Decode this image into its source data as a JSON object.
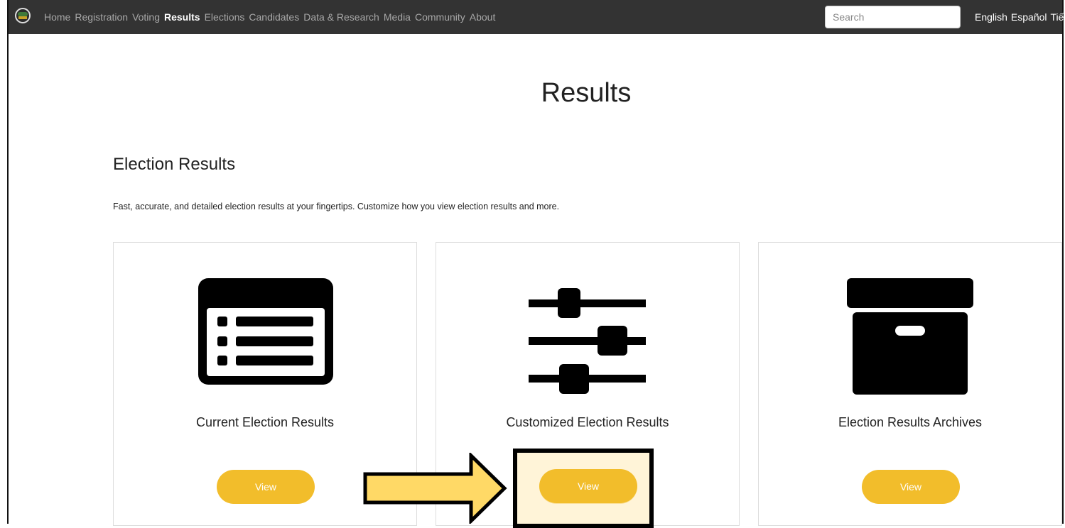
{
  "nav": {
    "items": [
      {
        "label": "Home",
        "active": false
      },
      {
        "label": "Registration",
        "active": false
      },
      {
        "label": "Voting",
        "active": false
      },
      {
        "label": "Results",
        "active": true
      },
      {
        "label": "Elections",
        "active": false
      },
      {
        "label": "Candidates",
        "active": false
      },
      {
        "label": "Data & Research",
        "active": false
      },
      {
        "label": "Media",
        "active": false
      },
      {
        "label": "Community",
        "active": false
      },
      {
        "label": "About",
        "active": false
      }
    ],
    "search_placeholder": "Search",
    "languages": [
      "English",
      "Español",
      "Tiế"
    ]
  },
  "page": {
    "title": "Results",
    "section_title": "Election Results",
    "section_description": "Fast, accurate, and detailed election results at your fingertips. Customize how you view election results and more."
  },
  "cards": [
    {
      "title": "Current Election Results",
      "button_label": "View",
      "icon": "list-icon"
    },
    {
      "title": "Customized Election Results",
      "button_label": "View",
      "icon": "sliders-icon"
    },
    {
      "title": "Election Results Archives",
      "button_label": "View",
      "icon": "archive-box-icon"
    }
  ],
  "colors": {
    "navbar": "#333333",
    "button": "#f2bd2b",
    "highlight_arrow": "#ffd966",
    "highlight_box_fill": "#fff2cc"
  }
}
